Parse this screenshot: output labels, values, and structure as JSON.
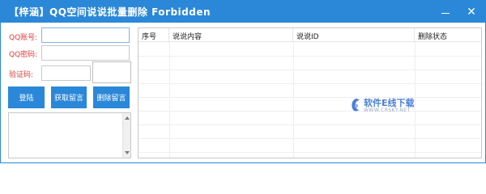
{
  "window": {
    "title": "【梓涵】QQ空间说说批量删除 Forbidden",
    "minimize_icon": "minimize-icon",
    "close_icon": "close-icon",
    "close_glyph": "✕"
  },
  "form": {
    "qq_label": "QQ账号:",
    "qq_value": "",
    "password_label": "QQ密码:",
    "password_value": "",
    "captcha_label": "验证码:",
    "captcha_value": ""
  },
  "buttons": {
    "login": "登陆",
    "fetch": "获取留言",
    "delete": "删除留言"
  },
  "log": {
    "text": ""
  },
  "table": {
    "columns": [
      "序号",
      "说说内容",
      "说说ID",
      "删除状态"
    ],
    "rows": []
  },
  "watermark": {
    "title": "软件E线下载",
    "url": "WWW.CRSKY.NET"
  },
  "colors": {
    "accent": "#2b88d8",
    "label_red": "#e23b3b"
  }
}
